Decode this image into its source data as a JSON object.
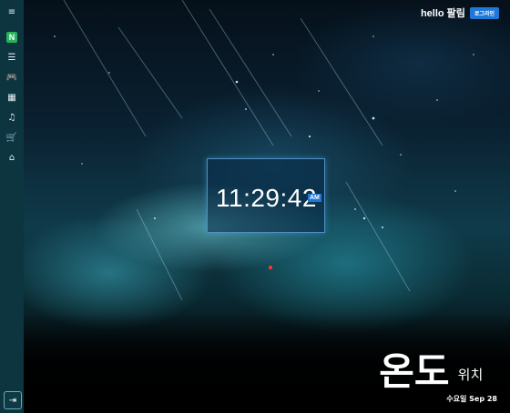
{
  "sidebar": {
    "menu_icon": "menu-icon",
    "items": [
      {
        "name": "naver-icon",
        "label": "N"
      },
      {
        "name": "list-icon",
        "glyph": "☰"
      },
      {
        "name": "gamepad-icon",
        "glyph": "🎮"
      },
      {
        "name": "calculator-icon",
        "glyph": "▦"
      },
      {
        "name": "music-icon",
        "glyph": "♫"
      },
      {
        "name": "cart-icon",
        "glyph": "🛒"
      },
      {
        "name": "home-icon",
        "glyph": "⌂"
      }
    ],
    "logout_glyph": "⇥"
  },
  "header": {
    "greeting": "hello 팔림",
    "login_label": "로그라인"
  },
  "clock": {
    "time": "11:29:42",
    "ampm": "AM"
  },
  "weather": {
    "temperature": "온도",
    "location": "위치",
    "date": "수요일 Sep 28"
  },
  "colors": {
    "sidebar": "#0c3540",
    "accent": "#1f78d8",
    "naver_green": "#27b35a"
  }
}
